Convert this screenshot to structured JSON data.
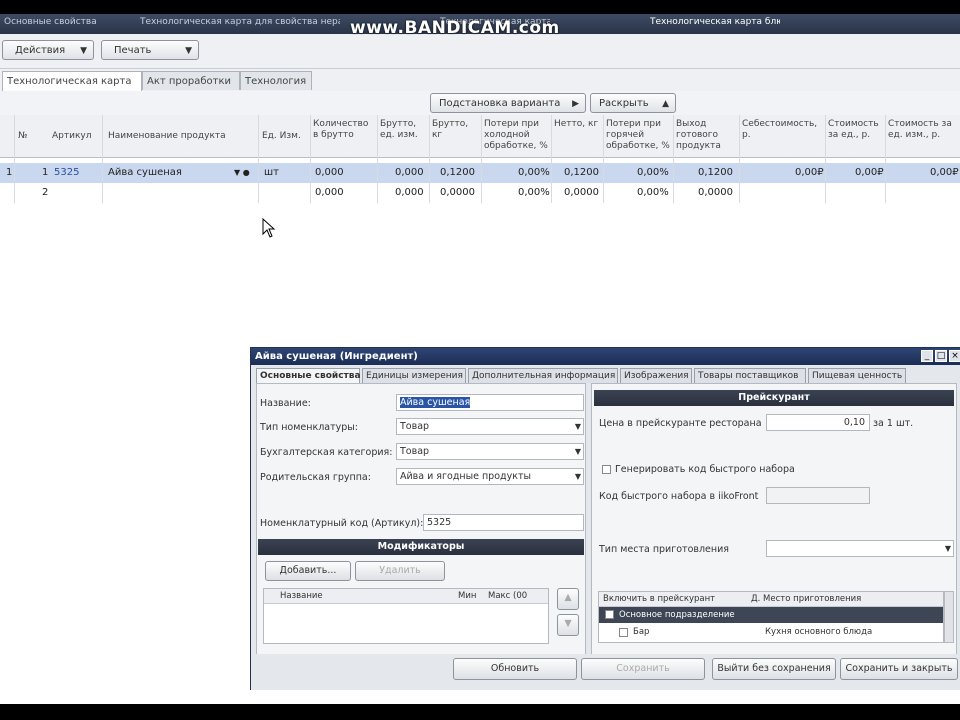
{
  "window_tabs": [
    "Основные свойства",
    "Технологическая карта для свойства неразданного",
    "Технологическая карта",
    "Технологическая карта блюда"
  ],
  "watermark": "www.BANDICAM.com",
  "toolbar": {
    "actions_label": "Действия",
    "print_label": "Печать"
  },
  "main_tabs": [
    "Технологическая карта",
    "Акт проработки",
    "Технология"
  ],
  "subbar": {
    "substitution_label": "Подстановка варианта",
    "cost_label": "Раскрыть"
  },
  "table": {
    "columns": [
      "№",
      "Артикул",
      "Наименование продукта",
      "Ед. Изм.",
      "Количество в брутто",
      "Брутто, ед. изм.",
      "Брутто, кг",
      "Потери при холодной обработке, %",
      "Нетто, кг",
      "Потери при горячей обработке, %",
      "Выход готового продукта",
      "Себестоимость, р.",
      "Стоимость за ед., р.",
      "Стоимость за ед. изм., р."
    ],
    "rows": [
      {
        "row_num": "1",
        "no": "1",
        "article": "5325",
        "name": "Айва сушеная",
        "unit": "шт",
        "qty": "0,000",
        "gross_unit": "0,000",
        "gross_kg": "0,1200",
        "loss_cold": "0,00%",
        "net": "0,1200",
        "loss_hot": "0,00%",
        "yield": "0,1200",
        "cost": "0,00₽",
        "price_unit": "0,00₽",
        "price_meas": "0,00₽"
      },
      {
        "row_num": "",
        "no": "2",
        "article": "",
        "name": "",
        "unit": "",
        "qty": "0,000",
        "gross_unit": "0,000",
        "gross_kg": "0,0000",
        "loss_cold": "0,00%",
        "net": "0,0000",
        "loss_hot": "0,00%",
        "yield": "0,0000",
        "cost": "",
        "price_unit": "",
        "price_meas": ""
      }
    ]
  },
  "dialog": {
    "title": "Айва сушеная (Ингредиент)",
    "tabs": [
      "Основные свойства",
      "Единицы измерения",
      "Дополнительная информация",
      "Изображения",
      "Товары поставщиков",
      "Пищевая ценность"
    ],
    "fields": {
      "name_label": "Название:",
      "name_value": "Айва сушеная",
      "nomenclature_type_label": "Тип номенклатуры:",
      "nomenclature_type_value": "Товар",
      "accounting_category_label": "Бухгалтерская категория:",
      "accounting_category_value": "Товар",
      "parent_group_label": "Родительская группа:",
      "parent_group_value": "Айва и ягодные продукты",
      "code_label": "Номенклатурный код (Артикул):",
      "code_value": "5325"
    },
    "modifiers": {
      "section_label": "Модификаторы",
      "add_label": "Добавить...",
      "delete_label": "Удалить",
      "col_name": "Название",
      "col_min": "Мин",
      "col_max": "Макс (00"
    },
    "price": {
      "section_label": "Прейскурант",
      "price_label": "Цена в прейскуранте ресторана",
      "price_value": "0,10",
      "price_unit": "за 1 шт.",
      "quick_code_label": "Генерировать код быстрого набора",
      "quick_code_field_label": "Код быстрого набора в iikoFront",
      "cooking_type_label": "Тип места приготовления",
      "col_dept": "Включить в прейскурант",
      "col_place": "Д. Место приготовления",
      "group_row": "Основное подразделение",
      "sub_row": "Бар",
      "sub_row_place": "Кухня основного блюда"
    },
    "buttons": {
      "apply": "Обновить",
      "save": "Сохранить",
      "exit_no_save": "Выйти без сохранения",
      "save_close": "Сохранить и закрыть"
    }
  }
}
